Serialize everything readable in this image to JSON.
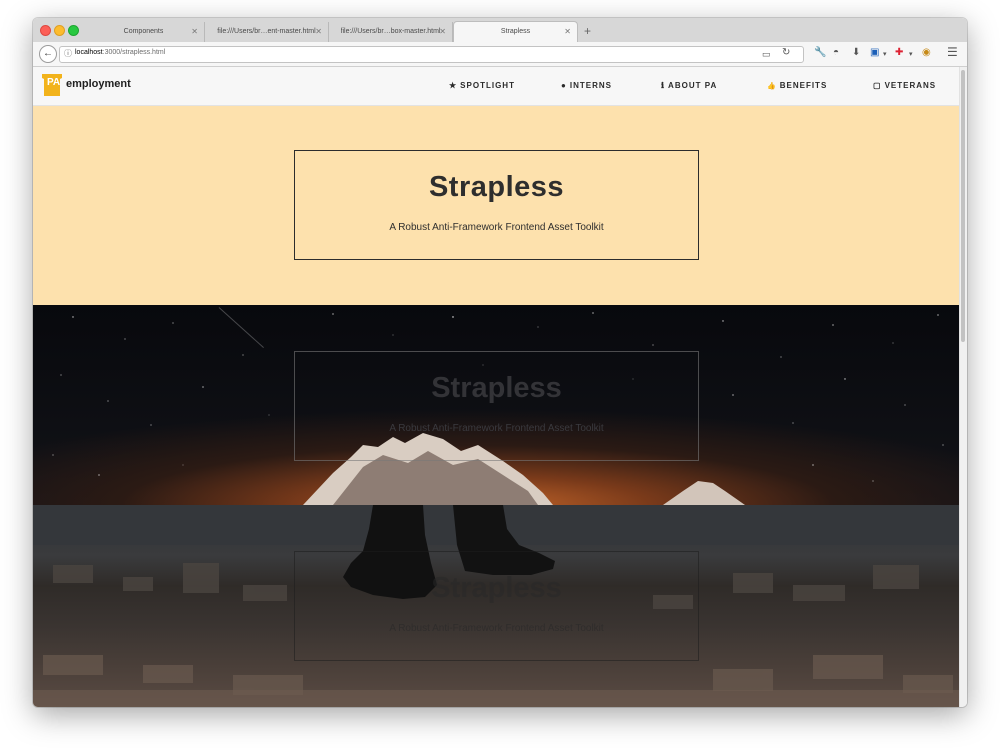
{
  "browser": {
    "tabs": [
      {
        "label": "Components",
        "active": false
      },
      {
        "label": "file:///Users/br…ent-master.html",
        "active": false
      },
      {
        "label": "file:///Users/br…box-master.html",
        "active": false
      },
      {
        "label": "Strapless",
        "active": true
      }
    ],
    "address": {
      "host": "localhost",
      "path": ":3000/strapless.html"
    }
  },
  "site": {
    "logo_text": "PA",
    "brand": "employment",
    "nav": [
      {
        "icon": "star-icon",
        "glyph": "★",
        "label": "SPOTLIGHT"
      },
      {
        "icon": "circle-icon",
        "glyph": "●",
        "label": "INTERNS"
      },
      {
        "icon": "info-icon",
        "glyph": "ℹ",
        "label": "ABOUT PA"
      },
      {
        "icon": "thumbs-up-icon",
        "glyph": "👍",
        "label": "BENEFITS"
      },
      {
        "icon": "square-icon",
        "glyph": "▢",
        "label": "VETERANS"
      }
    ]
  },
  "hero": {
    "title": "Strapless",
    "subtitle": "A Robust Anti-Framework Frontend Asset Toolkit"
  },
  "space_section": {
    "title": "Strapless",
    "subtitle": "A Robust Anti-Framework Frontend Asset Toolkit"
  },
  "city_section": {
    "title": "Strapless",
    "subtitle": "A Robust Anti-Framework Frontend Asset Toolkit"
  },
  "colors": {
    "hero_bg": "#fde1ad",
    "nav_bg": "#f7f7f7",
    "logo": "#f2b31b",
    "text": "#2e2e2e"
  }
}
